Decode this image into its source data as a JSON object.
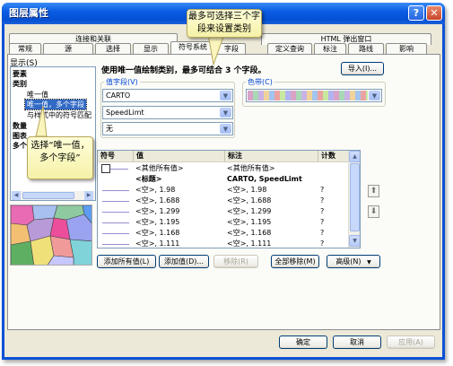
{
  "window": {
    "title": "图层属性",
    "help_icon": "?",
    "close_icon": "✕"
  },
  "tabs_row1": [
    "连接和关联",
    "HTML 弹出窗口"
  ],
  "tabs_row2": [
    "常规",
    "源",
    "选择",
    "显示",
    "符号系统",
    "字段",
    "定义查询",
    "标注",
    "路线",
    "影响"
  ],
  "show": {
    "label": "显示(S)",
    "items": [
      "要素",
      "类别",
      "唯一值",
      "唯一值，多个字段",
      "与样式中的符号匹配",
      "数量",
      "图表",
      "多个属性"
    ]
  },
  "description": "使用唯一值绘制类别，最多可结合 3 个字段。",
  "import_label": "导入(I)...",
  "value_fields": {
    "label": "值字段(V)",
    "field1": "CARTO",
    "field2": "SpeedLimt",
    "field3": "无"
  },
  "color_scheme": {
    "label": "色带(C)"
  },
  "table": {
    "headers": [
      "符号",
      "值",
      "标注",
      "计数"
    ],
    "rows": [
      {
        "value": "<其他所有值>",
        "label": "<其他所有值>",
        "count": "",
        "checkbox": true
      },
      {
        "value": "<标题>",
        "label": "CARTO, SpeedLimt",
        "count": "",
        "bold": true
      },
      {
        "value": "<空>, 1.98",
        "label": "<空>, 1.98",
        "count": "?"
      },
      {
        "value": "<空>, 1.688",
        "label": "<空>, 1.688",
        "count": "?"
      },
      {
        "value": "<空>, 1.299",
        "label": "<空>, 1.299",
        "count": "?"
      },
      {
        "value": "<空>, 1.195",
        "label": "<空>, 1.195",
        "count": "?"
      },
      {
        "value": "<空>, 1.168",
        "label": "<空>, 1.168",
        "count": "?"
      },
      {
        "value": "<空>, 1.111",
        "label": "<空>, 1.111",
        "count": "?"
      }
    ]
  },
  "buttons": {
    "add_all": "添加所有值(L)",
    "add": "添加值(D)...",
    "remove": "移除(R)",
    "remove_all": "全部移除(M)",
    "advanced": "高级(N)",
    "ok": "确定",
    "cancel": "取消",
    "apply": "应用(A)"
  },
  "callouts": {
    "top": "最多可选择三个字段来设置类别",
    "left": "选择“唯一值，多个字段”"
  },
  "colors": {
    "title_bar": "#0a5ce3",
    "selected_item": "#316ac5",
    "line_symbol": "#9b8bd0",
    "callout_fill": "#fefed8"
  }
}
